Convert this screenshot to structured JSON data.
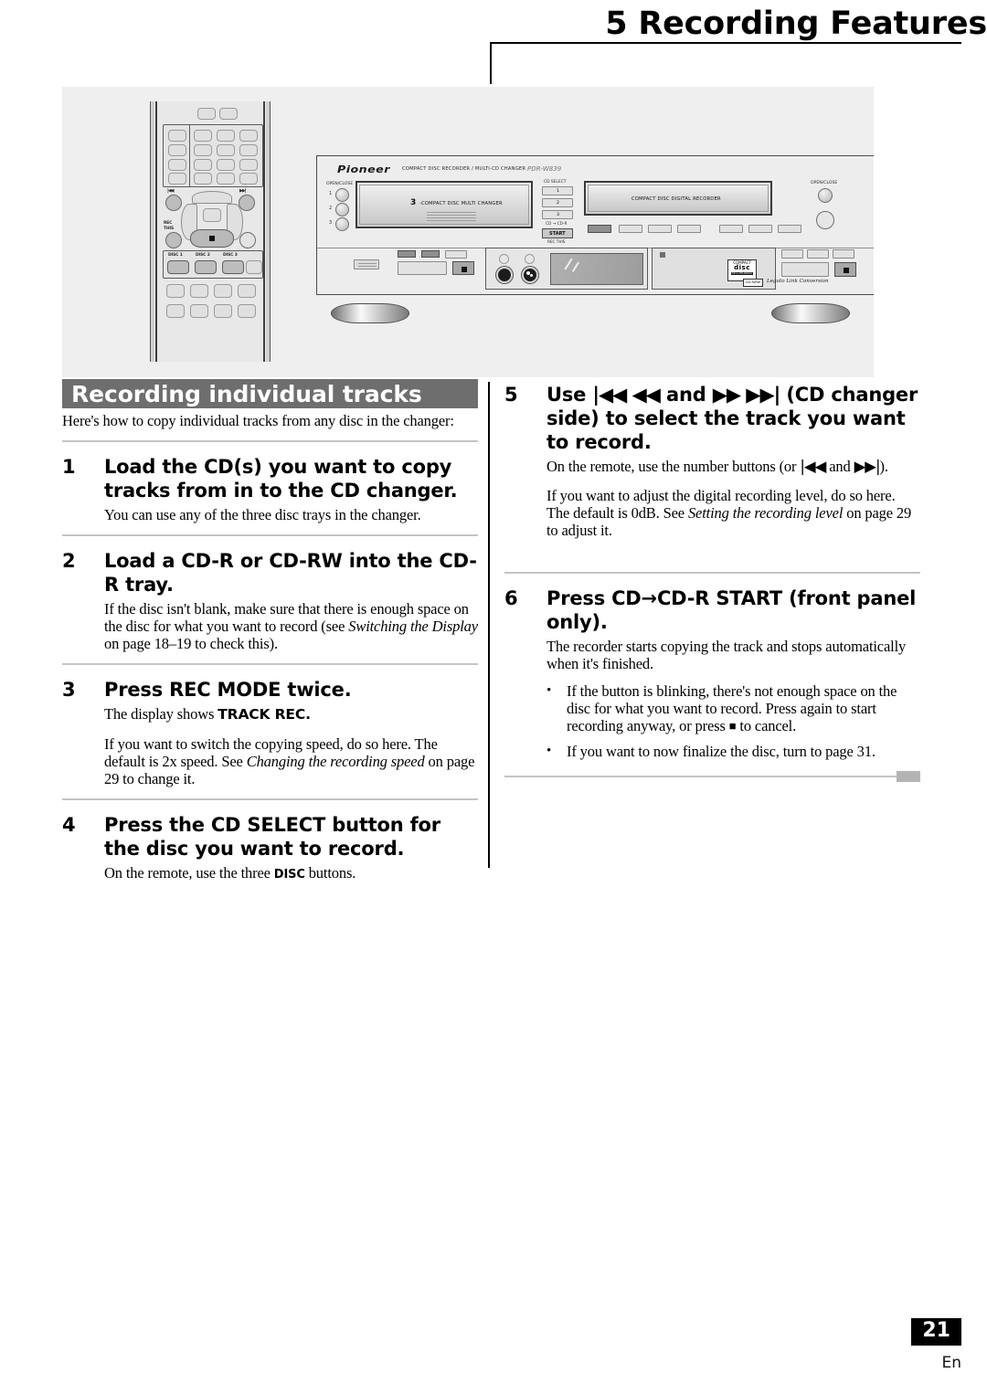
{
  "header": {
    "chapter_title": "5 Recording Features"
  },
  "illustration": {
    "remote": {
      "rec_this_label": "REC\nTHIS",
      "rec_this_line1": "REC",
      "rec_this_line2": "THIS",
      "disc_buttons": [
        "DISC 1",
        "DISC 2",
        "DISC 3"
      ],
      "skip_back": "|◀◀",
      "skip_fwd": "▶▶|",
      "stop_symbol": "■"
    },
    "deck": {
      "brand": "Pioneer",
      "product_line": "COMPACT DISC RECORDER / MULTI-CD CHANGER",
      "model": "PDR-W839",
      "open_close_left": "OPEN/CLOSE",
      "open_close_right": "OPEN/CLOSE",
      "tray_numbers": [
        "1",
        "2",
        "3"
      ],
      "changer_tray_text_num": "3",
      "changer_tray_text": "-COMPACT DISC MULTI CHANGER",
      "recorder_tray_text": "COMPACT DISC DIGITAL RECORDER",
      "cd_select_label": "CD SELECT",
      "cd_select_buttons": [
        "1",
        "2",
        "3"
      ],
      "cd_to_cdr_label": "CD → CD-R",
      "start_button": "START",
      "rec_this_label": "REC THIS",
      "legato_logo_mark": "CD-R/RW",
      "legato_text": "Legato Link Conversion",
      "disc_logo": "disc"
    }
  },
  "left_column": {
    "section_heading": "Recording individual tracks",
    "intro": "Here's how to copy individual tracks from any disc in the changer:",
    "steps": [
      {
        "num": "1",
        "title": "Load the CD(s) you want to copy tracks from in to the CD changer.",
        "paragraphs": [
          "You can use any of the three disc trays in the changer."
        ]
      },
      {
        "num": "2",
        "title": "Load a CD-R or CD-RW into the CD-R tray.",
        "paragraphs": [
          "If the disc isn't blank, make sure that there is enough space on the disc for what you want to record (see Switching the Display on page 18–19 to check this)."
        ],
        "p1_pre": "If the disc isn't blank, make sure that there is enough space on the disc for what you want to record (see ",
        "p1_italic": "Switching the Display",
        "p1_post": " on page 18–19 to check this)."
      },
      {
        "num": "3",
        "title": "Press REC MODE twice.",
        "p1_pre": "The display shows ",
        "p1_bold": "TRACK REC.",
        "p2_pre": "If you want to switch the copying speed, do so here. The default is 2x speed. See ",
        "p2_italic": "Changing the recording speed",
        "p2_post": " on page 29 to change it."
      },
      {
        "num": "4",
        "title": "Press the CD SELECT button for the disc you want to record.",
        "p1_pre": "On the remote, use the three ",
        "p1_bold": "DISC",
        "p1_post": " buttons."
      }
    ]
  },
  "right_column": {
    "steps": [
      {
        "num": "5",
        "title_pre": "Use ",
        "title_arrows_1": "|◀◀ ◀◀",
        "title_mid": " and ",
        "title_arrows_2": "▶▶ ▶▶|",
        "title_post": " (CD changer side) to select the track you want to record.",
        "p1_pre": "On the remote, use the number buttons (or ",
        "p1_arrow_1": "|◀◀",
        "p1_mid": " and ",
        "p1_arrow_2": "▶▶|",
        "p1_post": ").",
        "p2_pre": "If you want to adjust the digital recording level, do so here. The default is 0dB. See ",
        "p2_italic": "Setting the recording level",
        "p2_post": " on page 29 to adjust it."
      },
      {
        "num": "6",
        "title_pre": "Press CD",
        "title_arrow": "→",
        "title_post": "CD-R START (front panel only).",
        "p1": "The recorder starts copying the track and stops automatically when it's finished.",
        "bullets": [
          {
            "pre": "If the button is blinking, there's not enough space on the disc for what you want to record. Press again to start recording anyway, or press ",
            "symbol": "■",
            "post": " to cancel."
          },
          {
            "pre": "If you want to now finalize the disc, turn to page 31.",
            "symbol": "",
            "post": ""
          }
        ]
      }
    ]
  },
  "footer": {
    "page_number": "21",
    "language": "En"
  }
}
